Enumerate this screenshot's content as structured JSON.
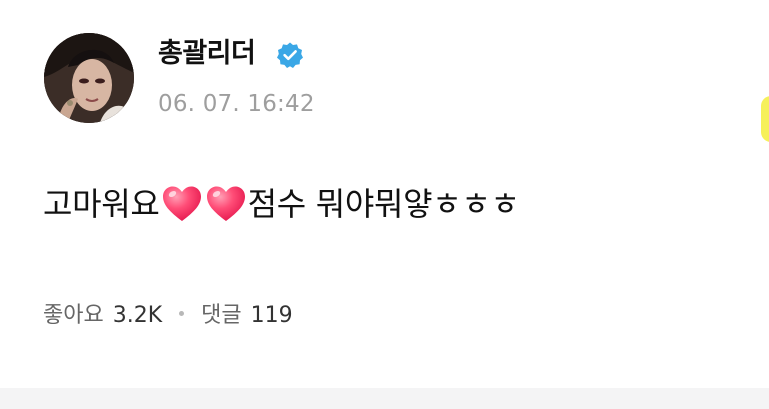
{
  "post": {
    "author_name": "총괄리더",
    "verified": true,
    "timestamp": "06. 07. 16:42",
    "text_part1": "고마워요",
    "text_part2": "점수 뭐야뭐얗ㅎㅎㅎ",
    "emoji": [
      "heart-icon",
      "heart-icon"
    ]
  },
  "stats": {
    "likes_label": "좋아요",
    "likes_count": "3.2K",
    "comments_label": "댓글",
    "comments_count": "119"
  },
  "colors": {
    "verified_badge": "#3aa7e6",
    "timestamp_text": "#9e9e9e",
    "heart": "#ff3b6b",
    "divider_strip": "#f4f4f5",
    "edge_accent": "#f6f05a"
  }
}
